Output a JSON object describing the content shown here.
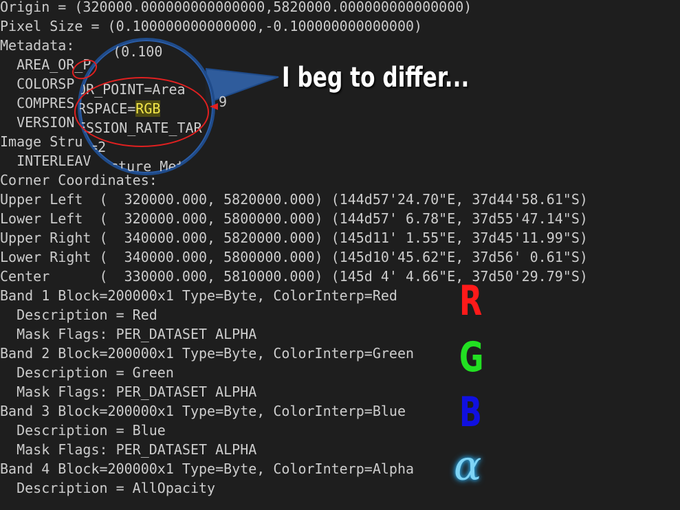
{
  "terminal": {
    "lines": [
      {
        "text": "Origin = (320000.000000000000000,5820000.000000000000000)"
      },
      {
        "text": "Pixel Size = (0.100000000000000,-0.100000000000000)"
      },
      {
        "text": "Metadata:"
      },
      {
        "text": "  AREA_OR_P"
      },
      {
        "text": "  COLORSP"
      },
      {
        "text": "  COMPRES"
      },
      {
        "text": "  VERSION"
      },
      {
        "text": "Image Stru"
      },
      {
        "text": "  INTERLEAV"
      },
      {
        "text": "Corner Coordinates:"
      },
      {
        "text": "Upper Left  (  320000.000, 5820000.000) (144d57'24.70\"E, 37d44'58.61\"S)"
      },
      {
        "text": "Lower Left  (  320000.000, 5800000.000) (144d57' 6.78\"E, 37d55'47.14\"S)"
      },
      {
        "text": "Upper Right (  340000.000, 5820000.000) (145d11' 1.55\"E, 37d45'11.99\"S)"
      },
      {
        "text": "Lower Right (  340000.000, 5800000.000) (145d10'45.62\"E, 37d56' 0.61\"S)"
      },
      {
        "text": "Center      (  330000.000, 5810000.000) (145d 4' 4.66\"E, 37d50'29.79\"S)"
      },
      {
        "text": "Band 1 Block=200000x1 Type=Byte, ColorInterp=Red"
      },
      {
        "text": "  Description = Red"
      },
      {
        "text": "  Mask Flags: PER_DATASET ALPHA"
      },
      {
        "text": "Band 2 Block=200000x1 Type=Byte, ColorInterp=Green"
      },
      {
        "text": "  Description = Green"
      },
      {
        "text": "  Mask Flags: PER_DATASET ALPHA"
      },
      {
        "text": "Band 3 Block=200000x1 Type=Byte, ColorInterp=Blue"
      },
      {
        "text": "  Description = Blue"
      },
      {
        "text": "  Mask Flags: PER_DATASET ALPHA"
      },
      {
        "text": "Band 4 Block=200000x1 Type=Byte, ColorInterp=Alpha"
      },
      {
        "text": "  Description = AllOpacity"
      }
    ]
  },
  "magnifier": {
    "line_top": " = (0.100",
    "line_area": "OR_POINT=Area",
    "line_space_prefix": "RSPACE=",
    "line_space_value": "RGB",
    "line_compression": "ESSION_RATE_TAR",
    "line_version": "N=2",
    "line_structure": "ucture Met",
    "trailing_fragment": "9"
  },
  "callout": {
    "text": "I beg to differ..."
  },
  "annotations": {
    "red_letter": "R",
    "green_letter": "G",
    "blue_letter": "B",
    "alpha_symbol": "α",
    "red_color": "#ff1a1a",
    "green_color": "#22e022",
    "blue_color": "#1010e0"
  }
}
